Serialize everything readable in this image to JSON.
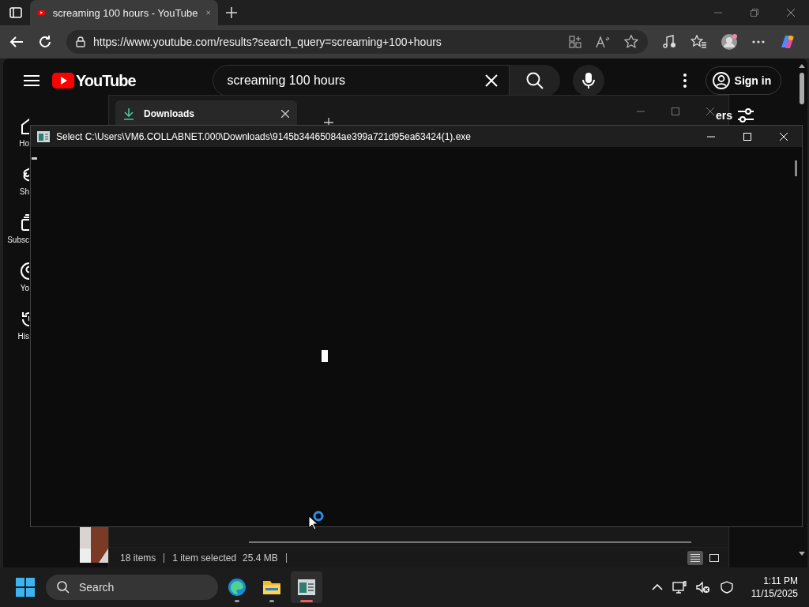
{
  "browser": {
    "tab": {
      "title": "screaming 100 hours - YouTube",
      "selected": true
    },
    "url": "https://www.youtube.com/results?search_query=screaming+100+hours"
  },
  "youtube": {
    "logo": "YouTube",
    "search": {
      "value": "screaming 100 hours"
    },
    "sign_in": "Sign in",
    "filters": "ers",
    "sidebar": [
      {
        "label": "Ho",
        "kind": "home"
      },
      {
        "label": "Sh",
        "kind": "shorts"
      },
      {
        "label": "Subsc",
        "kind": "subs"
      },
      {
        "label": "Yo",
        "kind": "you"
      },
      {
        "label": "His",
        "kind": "history"
      }
    ]
  },
  "explorer": {
    "tab": "Downloads",
    "status": [
      "18 items",
      "1 item selected",
      "25.4 MB"
    ],
    "views": [
      {
        "kind": "details",
        "selected": true
      },
      {
        "kind": "tiles",
        "selected": false
      }
    ]
  },
  "console": {
    "title": "Select C:\\Users\\VM6.COLLABNET.000\\Downloads\\9145b34465084ae399a721d95ea63424(1).exe"
  },
  "taskbar": {
    "search": {
      "placeholder": "Search"
    },
    "apps": [
      {
        "kind": "edge",
        "running": true,
        "active": false
      },
      {
        "kind": "explorer",
        "running": true,
        "active": false
      },
      {
        "kind": "console",
        "running": true,
        "active": true
      }
    ],
    "time": "1:11 PM",
    "date": "11/15/2025"
  }
}
